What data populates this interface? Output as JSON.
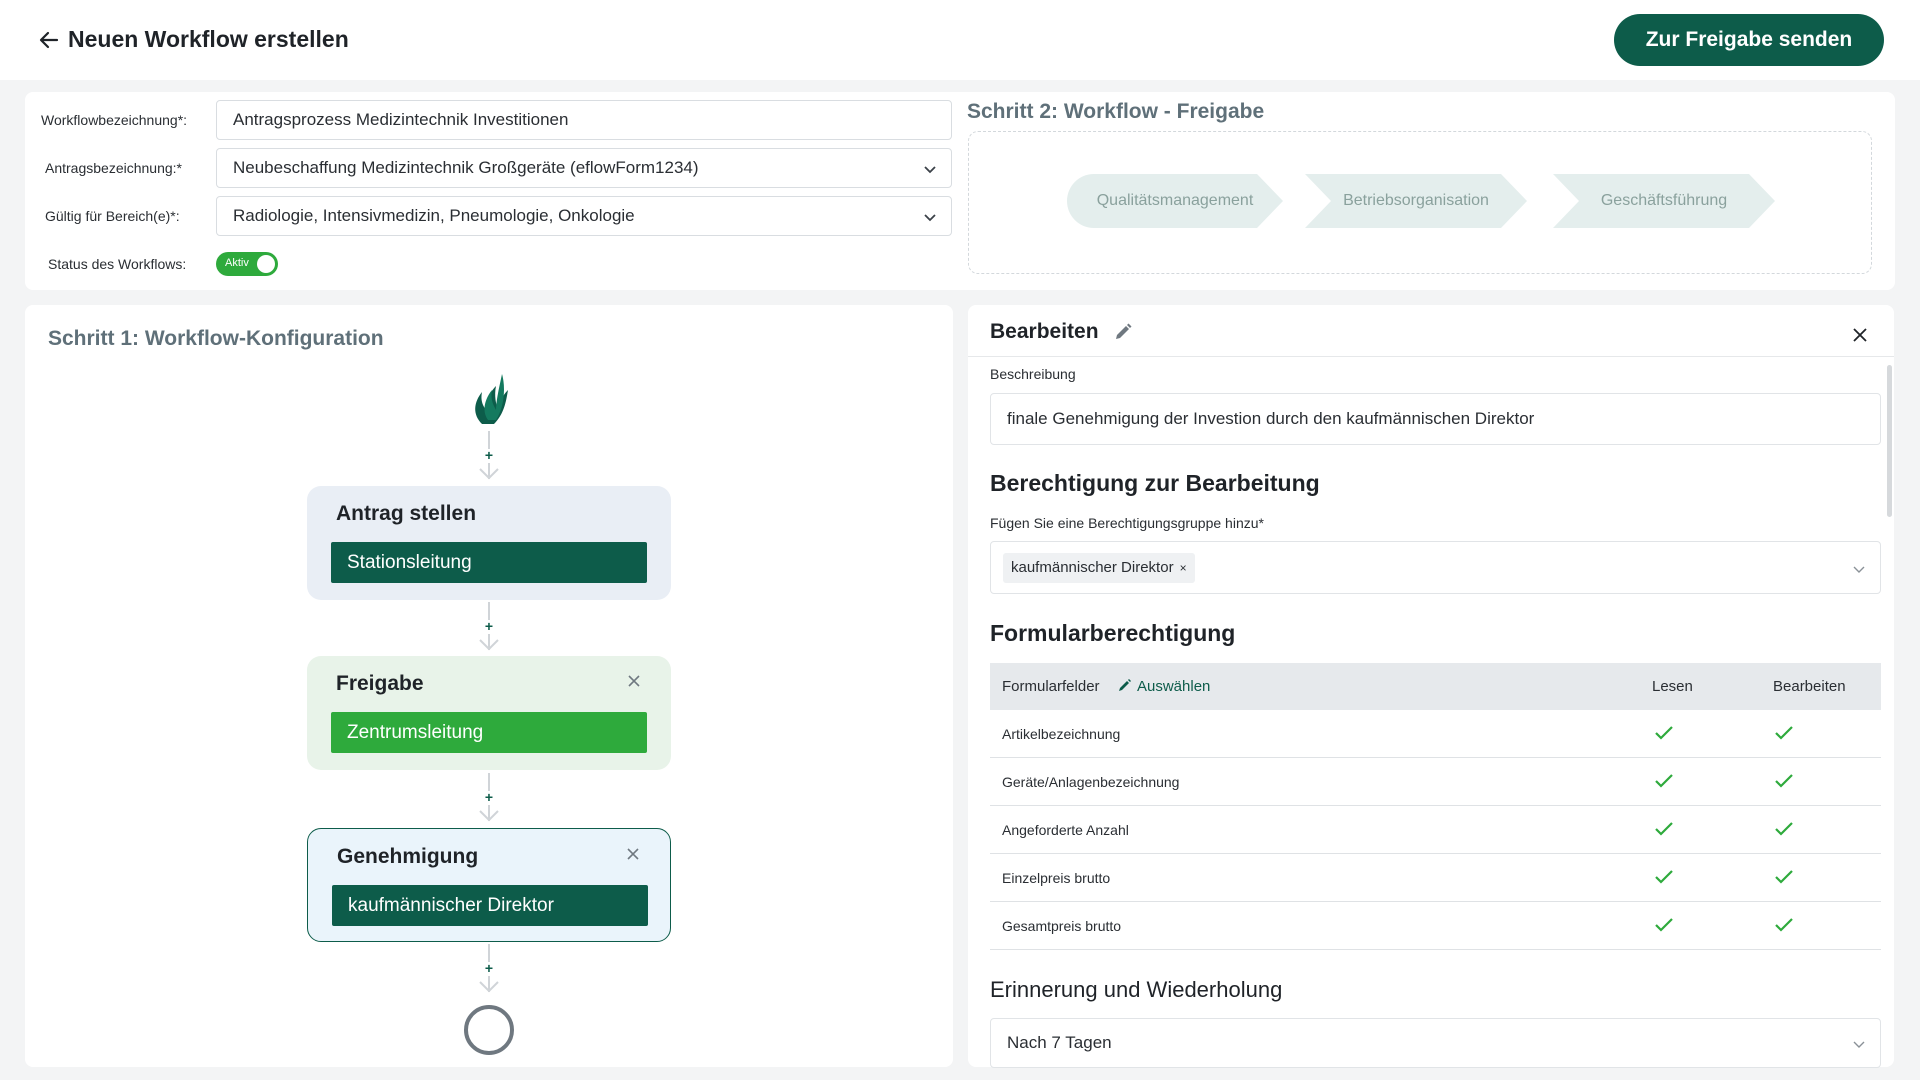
{
  "header": {
    "title": "Neuen Workflow erstellen",
    "send_label": "Zur Freigabe senden"
  },
  "form": {
    "workflow_label": "Workflowbezeichnung*:",
    "workflow_value": "Antragsprozess Medizintechnik Investitionen",
    "antrag_label": "Antragsbezeichnung:*",
    "antrag_value": "Neubeschaffung Medizintechnik Großgeräte (eflowForm1234)",
    "bereich_label": "Gültig für Bereich(e)*:",
    "bereich_value": "Radiologie, Intensivmedizin, Pneumologie, Onkologie",
    "status_label": "Status des Workflows:",
    "status_value": "Aktiv"
  },
  "step2": {
    "title": "Schritt 2: Workflow - Freigabe",
    "steps": [
      "Qualitätsmanagement",
      "Betriebsorganisation",
      "Geschäftsführung"
    ]
  },
  "step1": {
    "title": "Schritt 1: Workflow-Konfiguration",
    "nodes": [
      {
        "title": "Antrag stellen",
        "role": "Stationsleitung"
      },
      {
        "title": "Freigabe",
        "role": "Zentrumsleitung"
      },
      {
        "title": "Genehmigung",
        "role": "kaufmännischer Direktor"
      }
    ]
  },
  "edit_panel": {
    "title": "Bearbeiten",
    "desc_label": "Beschreibung",
    "desc_value": "finale Genehmigung der Investion durch den kaufmännischen Direktor",
    "perm_heading": "Berechtigung zur Bearbeitung",
    "perm_label": "Fügen Sie eine Berechtigungsgruppe hinzu*",
    "perm_tag": "kaufmännischer Direktor",
    "form_heading": "Formularberechtigung",
    "table": {
      "col_fields": "Formularfelder",
      "select_label": "Auswählen",
      "col_read": "Lesen",
      "col_edit": "Bearbeiten",
      "rows": [
        {
          "name": "Artikelbezeichnung",
          "read": true,
          "edit": true
        },
        {
          "name": "Geräte/Anlagenbezeichnung",
          "read": true,
          "edit": true
        },
        {
          "name": "Angeforderte Anzahl",
          "read": true,
          "edit": true
        },
        {
          "name": "Einzelpreis brutto",
          "read": true,
          "edit": true
        },
        {
          "name": "Gesamtpreis brutto",
          "read": true,
          "edit": true
        }
      ]
    },
    "reminder_heading": "Erinnerung und Wiederholung",
    "reminder_value": "Nach 7 Tagen"
  },
  "colors": {
    "brand_dark_green": "#0d5c4a",
    "bright_green": "#2eaa3c",
    "check_green": "#2eaa3c"
  }
}
